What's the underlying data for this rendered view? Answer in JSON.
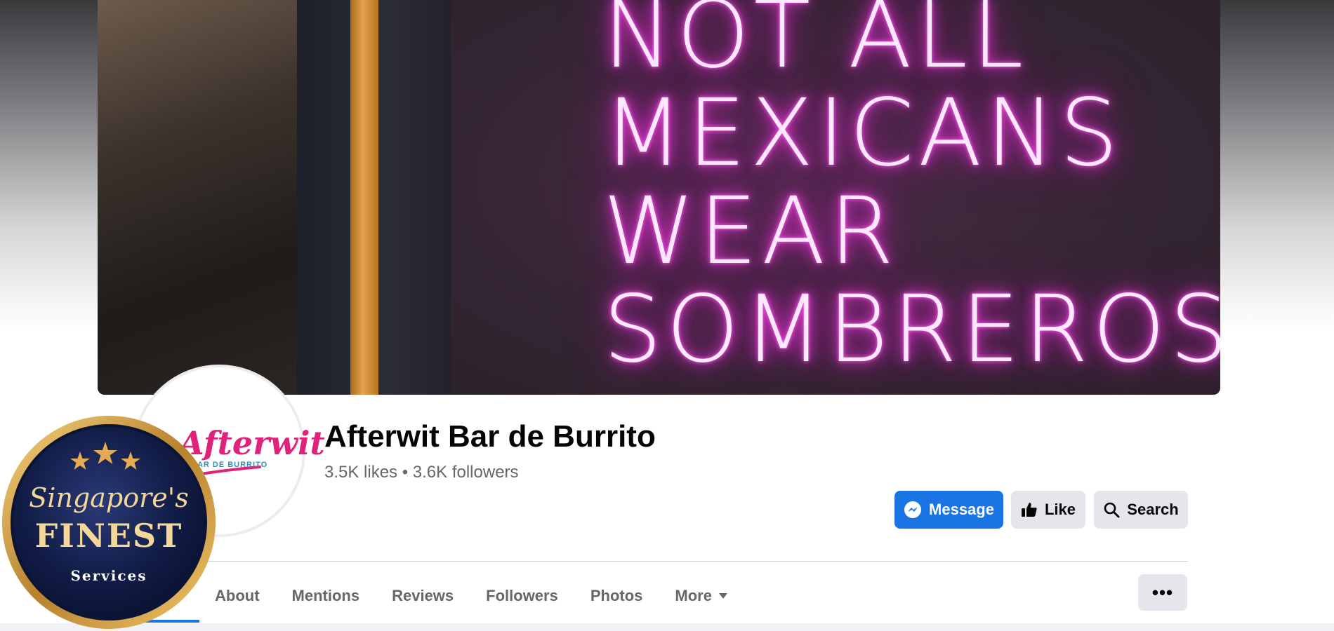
{
  "cover": {
    "neon_lines": [
      "NOT ALL",
      "MEXICANS",
      "WEAR",
      "SOMBREROS"
    ]
  },
  "profile": {
    "logo_word": "Afterwit",
    "logo_sub": "BAR DE BURRITO"
  },
  "page": {
    "name": "Afterwit Bar de Burrito",
    "stats": "3.5K likes • 3.6K followers"
  },
  "actions": {
    "message": "Message",
    "like": "Like",
    "search": "Search"
  },
  "tabs": [
    {
      "label": "About"
    },
    {
      "label": "Mentions"
    },
    {
      "label": "Reviews"
    },
    {
      "label": "Followers"
    },
    {
      "label": "Photos"
    },
    {
      "label": "More"
    }
  ],
  "more_options": "•••",
  "badge": {
    "script_text": "Singapore's",
    "main_text": "FINEST",
    "sub_text": "Services"
  },
  "colors": {
    "accent": "#1b74e4",
    "neon_pink": "#ff3ee6",
    "badge_gold": "#d4a04a",
    "badge_navy": "#0f1a3e"
  }
}
